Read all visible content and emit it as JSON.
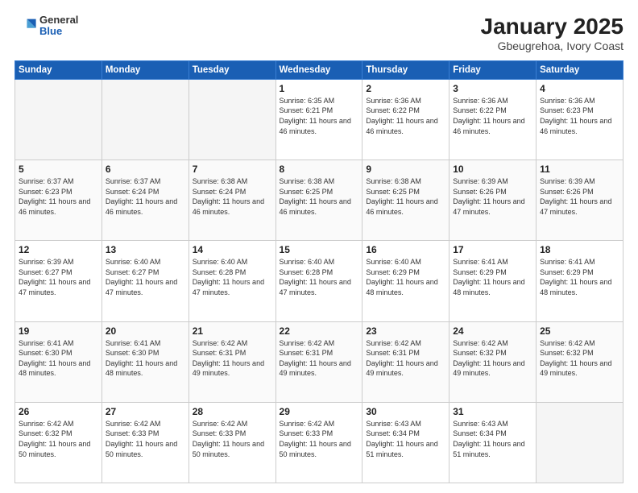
{
  "header": {
    "logo_general": "General",
    "logo_blue": "Blue",
    "title": "January 2025",
    "subtitle": "Gbeugrehoa, Ivory Coast"
  },
  "days_of_week": [
    "Sunday",
    "Monday",
    "Tuesday",
    "Wednesday",
    "Thursday",
    "Friday",
    "Saturday"
  ],
  "weeks": [
    [
      {
        "day": null,
        "sunrise": null,
        "sunset": null,
        "daylight": null
      },
      {
        "day": null,
        "sunrise": null,
        "sunset": null,
        "daylight": null
      },
      {
        "day": null,
        "sunrise": null,
        "sunset": null,
        "daylight": null
      },
      {
        "day": "1",
        "sunrise": "6:35 AM",
        "sunset": "6:21 PM",
        "daylight": "11 hours and 46 minutes."
      },
      {
        "day": "2",
        "sunrise": "6:36 AM",
        "sunset": "6:22 PM",
        "daylight": "11 hours and 46 minutes."
      },
      {
        "day": "3",
        "sunrise": "6:36 AM",
        "sunset": "6:22 PM",
        "daylight": "11 hours and 46 minutes."
      },
      {
        "day": "4",
        "sunrise": "6:36 AM",
        "sunset": "6:23 PM",
        "daylight": "11 hours and 46 minutes."
      }
    ],
    [
      {
        "day": "5",
        "sunrise": "6:37 AM",
        "sunset": "6:23 PM",
        "daylight": "11 hours and 46 minutes."
      },
      {
        "day": "6",
        "sunrise": "6:37 AM",
        "sunset": "6:24 PM",
        "daylight": "11 hours and 46 minutes."
      },
      {
        "day": "7",
        "sunrise": "6:38 AM",
        "sunset": "6:24 PM",
        "daylight": "11 hours and 46 minutes."
      },
      {
        "day": "8",
        "sunrise": "6:38 AM",
        "sunset": "6:25 PM",
        "daylight": "11 hours and 46 minutes."
      },
      {
        "day": "9",
        "sunrise": "6:38 AM",
        "sunset": "6:25 PM",
        "daylight": "11 hours and 46 minutes."
      },
      {
        "day": "10",
        "sunrise": "6:39 AM",
        "sunset": "6:26 PM",
        "daylight": "11 hours and 47 minutes."
      },
      {
        "day": "11",
        "sunrise": "6:39 AM",
        "sunset": "6:26 PM",
        "daylight": "11 hours and 47 minutes."
      }
    ],
    [
      {
        "day": "12",
        "sunrise": "6:39 AM",
        "sunset": "6:27 PM",
        "daylight": "11 hours and 47 minutes."
      },
      {
        "day": "13",
        "sunrise": "6:40 AM",
        "sunset": "6:27 PM",
        "daylight": "11 hours and 47 minutes."
      },
      {
        "day": "14",
        "sunrise": "6:40 AM",
        "sunset": "6:28 PM",
        "daylight": "11 hours and 47 minutes."
      },
      {
        "day": "15",
        "sunrise": "6:40 AM",
        "sunset": "6:28 PM",
        "daylight": "11 hours and 47 minutes."
      },
      {
        "day": "16",
        "sunrise": "6:40 AM",
        "sunset": "6:29 PM",
        "daylight": "11 hours and 48 minutes."
      },
      {
        "day": "17",
        "sunrise": "6:41 AM",
        "sunset": "6:29 PM",
        "daylight": "11 hours and 48 minutes."
      },
      {
        "day": "18",
        "sunrise": "6:41 AM",
        "sunset": "6:29 PM",
        "daylight": "11 hours and 48 minutes."
      }
    ],
    [
      {
        "day": "19",
        "sunrise": "6:41 AM",
        "sunset": "6:30 PM",
        "daylight": "11 hours and 48 minutes."
      },
      {
        "day": "20",
        "sunrise": "6:41 AM",
        "sunset": "6:30 PM",
        "daylight": "11 hours and 48 minutes."
      },
      {
        "day": "21",
        "sunrise": "6:42 AM",
        "sunset": "6:31 PM",
        "daylight": "11 hours and 49 minutes."
      },
      {
        "day": "22",
        "sunrise": "6:42 AM",
        "sunset": "6:31 PM",
        "daylight": "11 hours and 49 minutes."
      },
      {
        "day": "23",
        "sunrise": "6:42 AM",
        "sunset": "6:31 PM",
        "daylight": "11 hours and 49 minutes."
      },
      {
        "day": "24",
        "sunrise": "6:42 AM",
        "sunset": "6:32 PM",
        "daylight": "11 hours and 49 minutes."
      },
      {
        "day": "25",
        "sunrise": "6:42 AM",
        "sunset": "6:32 PM",
        "daylight": "11 hours and 49 minutes."
      }
    ],
    [
      {
        "day": "26",
        "sunrise": "6:42 AM",
        "sunset": "6:32 PM",
        "daylight": "11 hours and 50 minutes."
      },
      {
        "day": "27",
        "sunrise": "6:42 AM",
        "sunset": "6:33 PM",
        "daylight": "11 hours and 50 minutes."
      },
      {
        "day": "28",
        "sunrise": "6:42 AM",
        "sunset": "6:33 PM",
        "daylight": "11 hours and 50 minutes."
      },
      {
        "day": "29",
        "sunrise": "6:42 AM",
        "sunset": "6:33 PM",
        "daylight": "11 hours and 50 minutes."
      },
      {
        "day": "30",
        "sunrise": "6:43 AM",
        "sunset": "6:34 PM",
        "daylight": "11 hours and 51 minutes."
      },
      {
        "day": "31",
        "sunrise": "6:43 AM",
        "sunset": "6:34 PM",
        "daylight": "11 hours and 51 minutes."
      },
      {
        "day": null,
        "sunrise": null,
        "sunset": null,
        "daylight": null
      }
    ]
  ]
}
